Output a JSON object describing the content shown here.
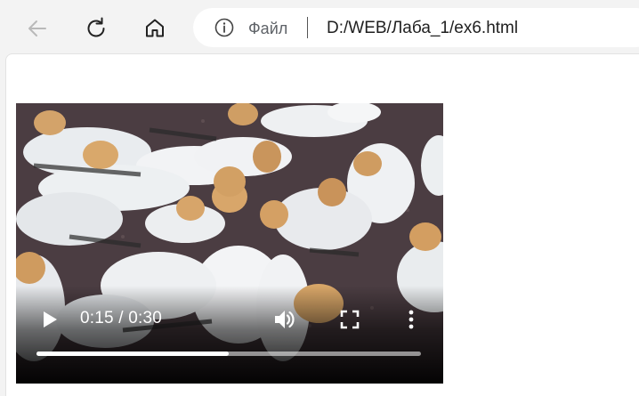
{
  "browser": {
    "back_icon": "arrow-left-icon",
    "reload_icon": "reload-icon",
    "home_icon": "home-icon",
    "info_icon": "info-icon",
    "origin_label": "Файл",
    "url": "D:/WEB/Лаба_1/ex6.html"
  },
  "video": {
    "current_time": "0:15",
    "duration": "0:30",
    "time_display": "0:15 / 0:30",
    "progress": 0.5,
    "play_icon": "play-icon",
    "volume_icon": "volume-icon",
    "fullscreen_icon": "fullscreen-icon",
    "more_icon": "more-vertical-icon"
  }
}
